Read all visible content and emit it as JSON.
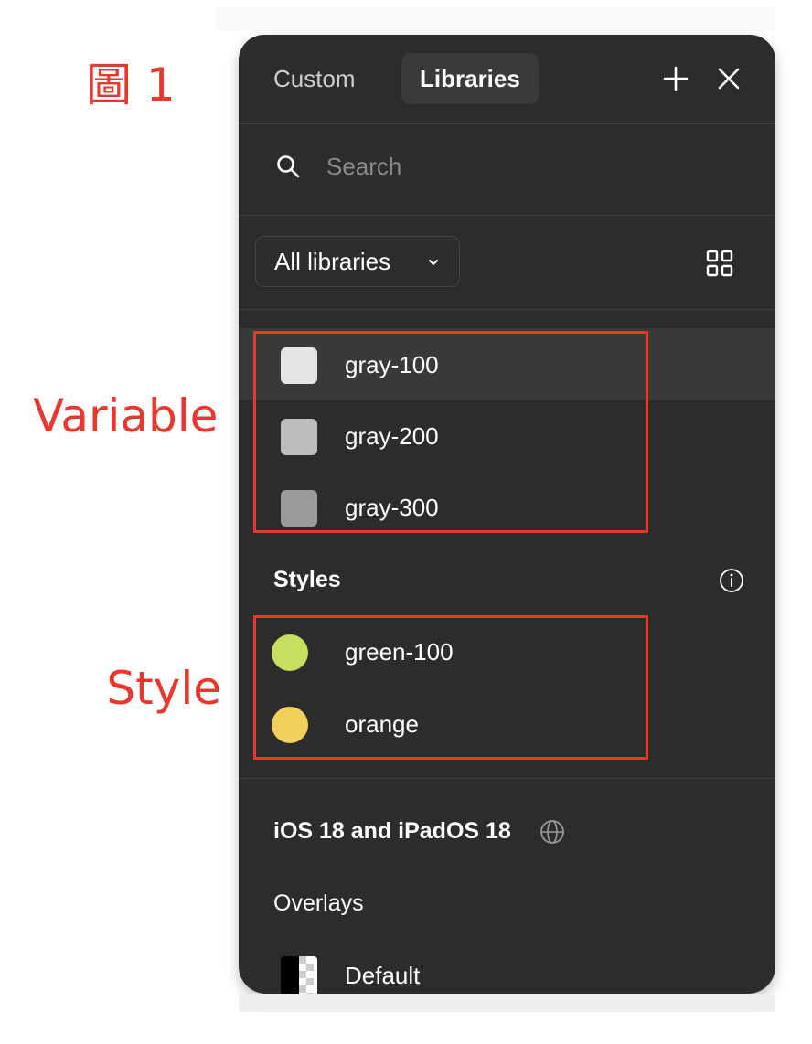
{
  "annotations": {
    "figure_label": "圖 1",
    "variable_label": "Variable",
    "style_label": "Style"
  },
  "header": {
    "tabs": [
      {
        "label": "Custom",
        "active": false
      },
      {
        "label": "Libraries",
        "active": true
      }
    ],
    "add_icon": "plus-icon",
    "close_icon": "close-icon"
  },
  "search": {
    "placeholder": "Search",
    "icon": "search-icon"
  },
  "filter": {
    "dropdown_value": "All libraries",
    "view_icon": "grid-view-icon"
  },
  "variables": [
    {
      "label": "gray-100",
      "color": "#e6e6e6",
      "selected": true
    },
    {
      "label": "gray-200",
      "color": "#bdbdbd",
      "selected": false
    },
    {
      "label": "gray-300",
      "color": "#9a9a9a",
      "selected": false
    }
  ],
  "styles_section": {
    "title": "Styles",
    "info_icon": "info-icon",
    "items": [
      {
        "label": "green-100",
        "color": "#c7df5f"
      },
      {
        "label": "orange",
        "color": "#f2cf5b"
      }
    ]
  },
  "library_section": {
    "title": "iOS 18 and iPadOS 18",
    "icon": "globe-icon"
  },
  "overlays_section": {
    "title": "Overlays",
    "items": [
      {
        "label": "Default"
      }
    ]
  },
  "colors": {
    "panel_bg": "#2c2c2c",
    "annotation_red": "#e8372c"
  }
}
